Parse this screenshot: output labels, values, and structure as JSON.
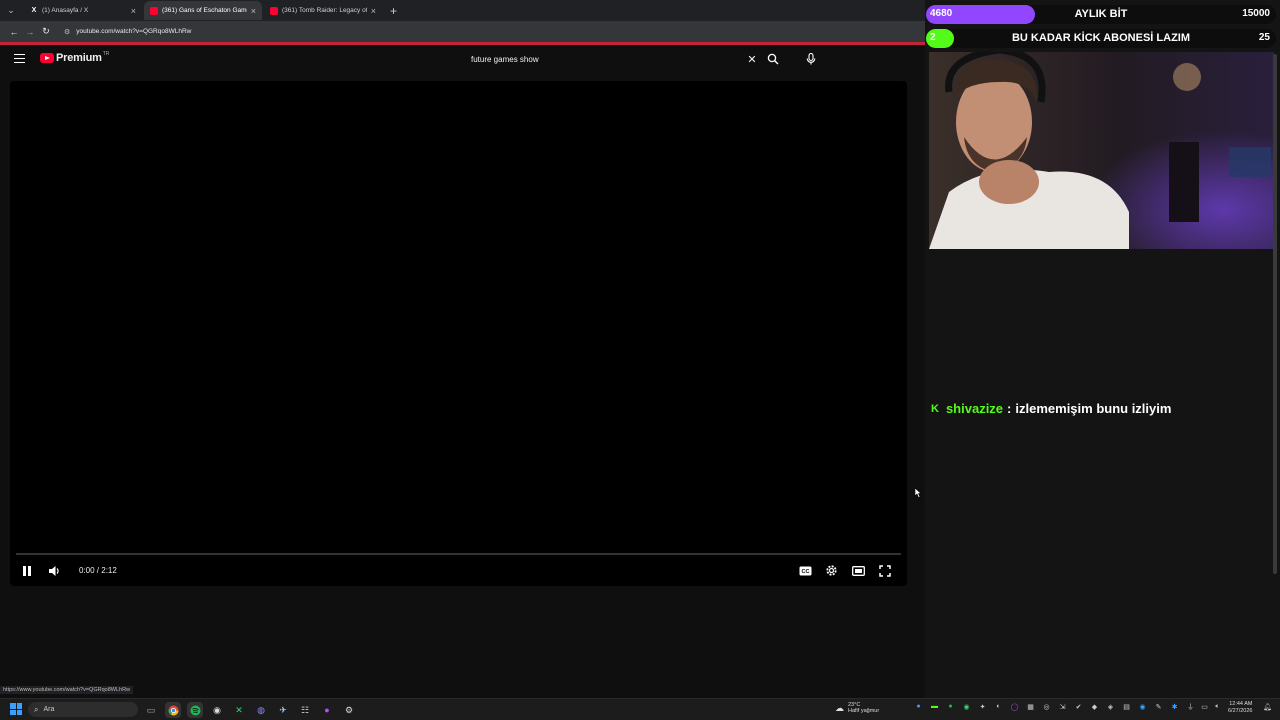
{
  "browser": {
    "tabs": [
      {
        "title": "(1) Anasayfa / X",
        "favicon": "x-logo-icon",
        "active": false
      },
      {
        "title": "(361) Gans of Eschaton Gamepl...",
        "favicon": "youtube-icon",
        "active": true
      },
      {
        "title": "(361) Tomb Raider: Legacy of A...",
        "favicon": "youtube-icon",
        "active": false
      }
    ],
    "url": "youtube.com/watch?v=QGRqo8WLhRw",
    "status_url": "https://www.youtube.com/watch?v=QGRqo8WLhRw"
  },
  "youtube": {
    "logo_text": "Premium",
    "region": "TR",
    "search_query": "future games show"
  },
  "player": {
    "current_time": "0:00",
    "duration": "2:12",
    "time_display": "0:00 / 2:12",
    "progress": 0.0,
    "state": "playing"
  },
  "overlay": {
    "sub_goal": {
      "current": "4680",
      "label": "AYLIK BİT",
      "goal": "15000",
      "fill_fraction": 0.312,
      "color": "#9147ff"
    },
    "kick_goal": {
      "current": "2",
      "label": "BU KADAR KİCK ABONESİ LAZIM",
      "goal": "25",
      "fill_fraction": 0.08,
      "color": "#53fc18"
    },
    "chat": {
      "username": "shivazize",
      "separator": ":",
      "message": "izlememişim bunu izliyim",
      "platform_icon": "kick-icon"
    }
  },
  "taskbar": {
    "search_placeholder": "Ara",
    "weather_temp": "23°C",
    "weather_desc": "Hafif yağmur",
    "time": "12:44 AM",
    "date": "6/27/2026"
  }
}
